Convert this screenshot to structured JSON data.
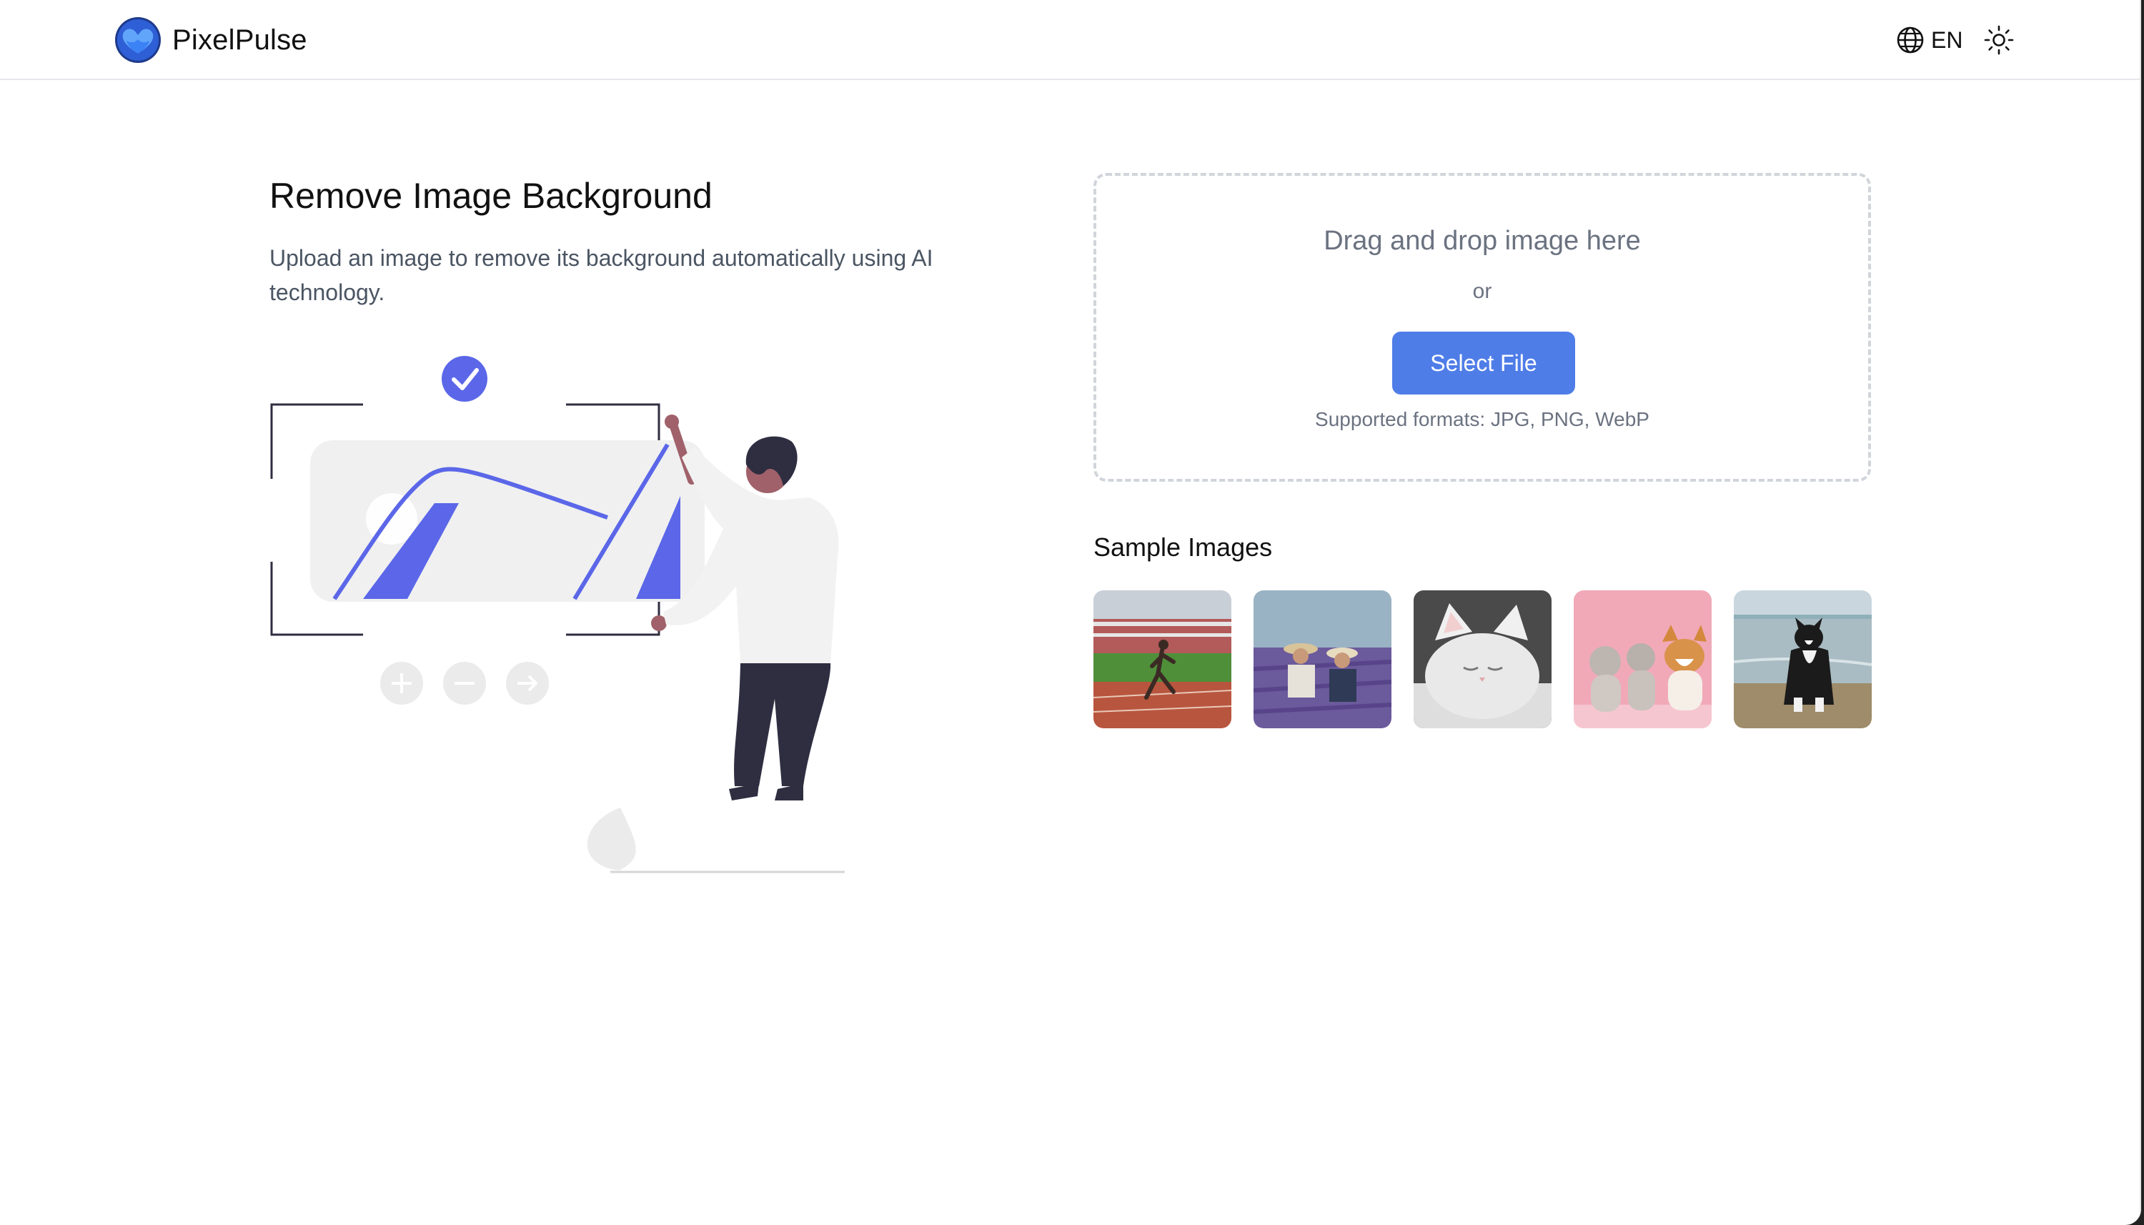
{
  "header": {
    "brand": "PixelPulse",
    "language": "EN",
    "icons": {
      "logo": "heart-logo-icon",
      "language": "globe-icon",
      "theme": "sun-icon"
    }
  },
  "hero": {
    "title": "Remove Image Background",
    "subtitle": "Upload an image to remove its background automatically using AI technology."
  },
  "upload": {
    "heading": "Drag and drop image here",
    "or": "or",
    "button": "Select File",
    "formats": "Supported formats: JPG, PNG, WebP"
  },
  "samples": {
    "title": "Sample Images"
  },
  "colors": {
    "accent": "#4f7de8",
    "illustration_accent": "#5b67e8",
    "text_muted": "#6b7280"
  }
}
